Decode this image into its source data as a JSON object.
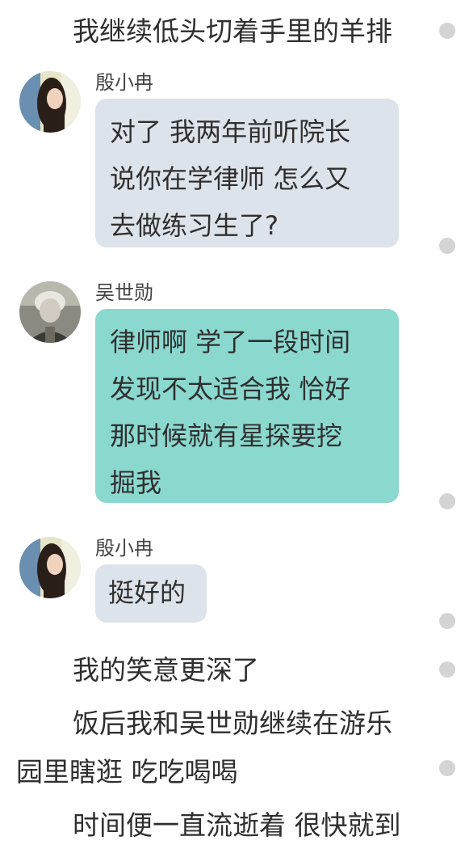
{
  "narration": {
    "line1": "我继续低头切着手里的羊排",
    "line2": "我的笑意更深了",
    "line3a": "饭后我和吴世勋继续在游乐",
    "line3b": "园里瞎逛 吃吃喝喝",
    "line4": "时间便一直流逝着 很快就到"
  },
  "messages": [
    {
      "speaker": "殷小冉",
      "avatar_icon": "girl-portrait-avatar",
      "lines": [
        "对了 我两年前听院长",
        "说你在学律师 怎么又",
        "去做练习生了?"
      ],
      "bubble_color": "#dde3ea"
    },
    {
      "speaker": "吴世勋",
      "avatar_icon": "boy-portrait-avatar",
      "lines": [
        "律师啊 学了一段时间",
        "发现不太适合我 恰好",
        "那时候就有星探要挖",
        "掘我"
      ],
      "bubble_color": "#8bd8cf"
    },
    {
      "speaker": "殷小冉",
      "avatar_icon": "girl-portrait-avatar",
      "lines": [
        "挺好的"
      ],
      "bubble_color": "#dde3ea"
    }
  ]
}
